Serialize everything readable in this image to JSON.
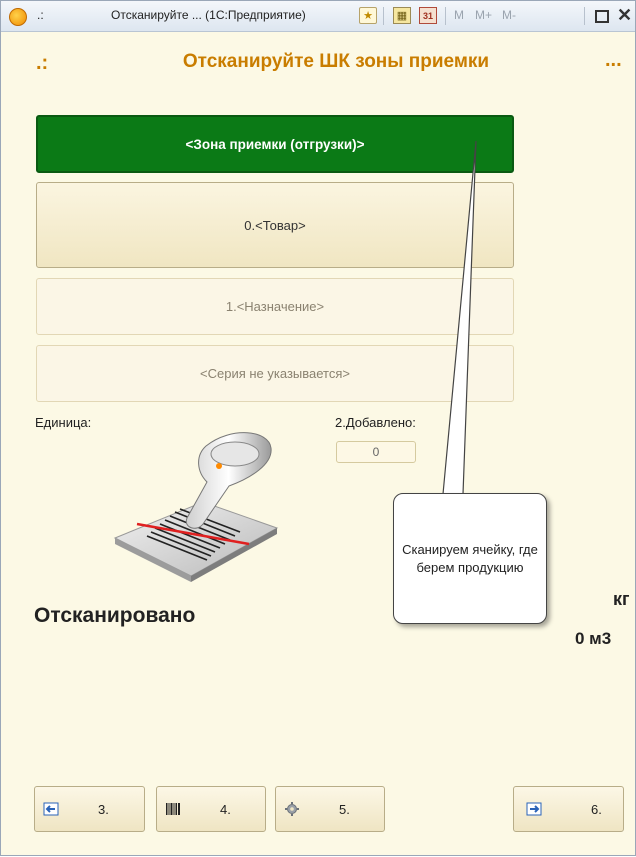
{
  "window": {
    "dots": ".:",
    "title": "Отсканируйте ... (1С:Предприятие)",
    "calendar_label": "31",
    "m_labels": [
      "M",
      "M+",
      "M-"
    ]
  },
  "header": {
    "left": ".:",
    "title": "Отсканируйте ШК зоны приемки",
    "right": "..."
  },
  "fields": {
    "zone": "<Зона приемки (отгрузки)>",
    "goods": "0.<Товар>",
    "destination": "1.<Назначение>",
    "series": "<Серия не указывается>"
  },
  "unit_label": "Единица:",
  "added": {
    "label": "2.Добавлено:",
    "value": "0"
  },
  "status": {
    "scanned": "Отсканировано",
    "weight_unit": "кг",
    "volume": "0 м3"
  },
  "callout": "Сканируем ячейку, где берем продукцию",
  "buttons": {
    "b3": "3.",
    "b4": "4.",
    "b5": "5.",
    "b6": "6."
  },
  "colors": {
    "accent": "#c97d00",
    "zone_green": "#0b7a16",
    "background": "#fcf9e5"
  }
}
